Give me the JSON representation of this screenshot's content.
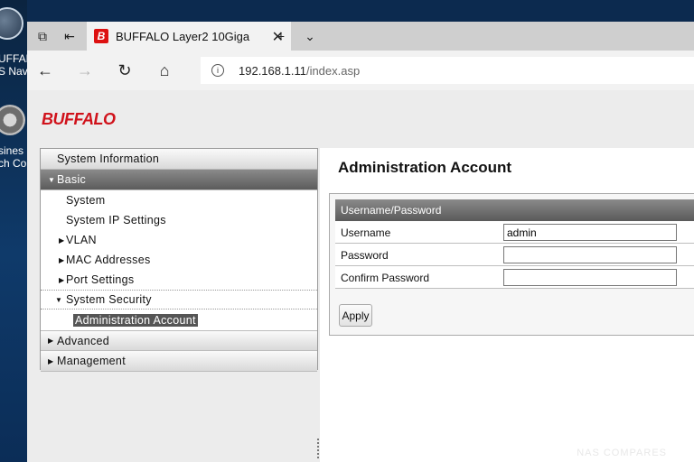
{
  "desktop": {
    "icon1_lines": [
      "UFFALC",
      "S Nav"
    ],
    "icon2_lines": [
      "sines",
      "ch Co"
    ]
  },
  "browser": {
    "tab_title": "BUFFALO Layer2 10Giga",
    "favicon_letter": "B",
    "url_host": "192.168.1.11",
    "url_path": "/index.asp"
  },
  "page": {
    "logo": "BUFFALO",
    "main_title": "Administration Account",
    "watermark": "NAS COMPARES"
  },
  "sidebar": {
    "system_information": "System Information",
    "basic": "Basic",
    "system": "System",
    "system_ip_settings": "System IP Settings",
    "vlan": "VLAN",
    "mac_addresses": "MAC Addresses",
    "port_settings": "Port Settings",
    "system_security": "System Security",
    "administration_account": "Administration Account",
    "advanced": "Advanced",
    "management": "Management"
  },
  "form": {
    "header": "Username/Password",
    "username_label": "Username",
    "username_value": "admin",
    "password_label": "Password",
    "password_value": "",
    "confirm_label": "Confirm Password",
    "confirm_value": "",
    "apply_label": "Apply"
  },
  "colors": {
    "brand": "#d0121b",
    "nav_active": "#5c5c5c"
  }
}
